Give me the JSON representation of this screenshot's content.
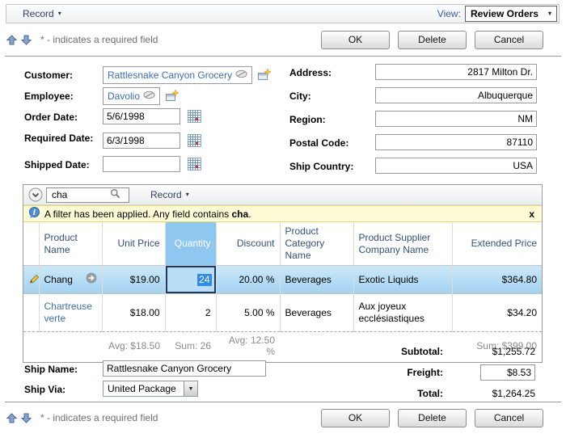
{
  "menubar": {
    "record": "Record",
    "view_label": "View:",
    "view_value": "Review Orders"
  },
  "toolbar": {
    "required_note": "* - indicates a required field",
    "ok_label": "OK",
    "delete_label": "Delete",
    "cancel_label": "Cancel"
  },
  "icons": {
    "caret_down": "▾",
    "select_arrow": "▼"
  },
  "fields": {
    "customer": {
      "label": "Customer:",
      "value": "Rattlesnake Canyon Grocery"
    },
    "employee": {
      "label": "Employee:",
      "value": "Davolio"
    },
    "order_date": {
      "label": "Order Date:",
      "value": "5/6/1998"
    },
    "required_date": {
      "label": "Required Date:",
      "value": "6/3/1998"
    },
    "shipped_date": {
      "label": "Shipped Date:",
      "value": ""
    },
    "address": {
      "label": "Address:",
      "value": "2817 Milton Dr."
    },
    "city": {
      "label": "City:",
      "value": "Albuquerque"
    },
    "region": {
      "label": "Region:",
      "value": "NM"
    },
    "postal_code": {
      "label": "Postal Code:",
      "value": "87110"
    },
    "ship_country": {
      "label": "Ship Country:",
      "value": "USA"
    },
    "ship_name": {
      "label": "Ship Name:",
      "value": "Rattlesnake Canyon Grocery"
    },
    "ship_via": {
      "label": "Ship Via:",
      "value": "United Package"
    }
  },
  "details_grid": {
    "search_value": "cha",
    "record_menu": "Record",
    "filter_message_prefix": "A filter has been applied. Any field contains ",
    "filter_term": "cha",
    "filter_suffix": ".",
    "close_label": "x",
    "columns": [
      "Product Name",
      "Unit Price",
      "Quantity",
      "Discount",
      "Product Category Name",
      "Product Supplier Company Name",
      "Extended Price"
    ],
    "rows": [
      {
        "selected": true,
        "product_name": "Chang",
        "unit_price": "$19.00",
        "quantity": "24",
        "discount": "20.00 %",
        "category": "Beverages",
        "supplier": "Exotic Liquids",
        "extended_price": "$364.80"
      },
      {
        "selected": false,
        "product_name": "Chartreuse verte",
        "unit_price": "$18.00",
        "quantity": "2",
        "discount": "5.00 %",
        "category": "Beverages",
        "supplier": "Aux joyeux ecclésiastiques",
        "extended_price": "$34.20"
      }
    ],
    "footer": {
      "unit_price": "Avg: $18.50",
      "quantity": "Sum: 26",
      "discount": "Avg: 12.50 %",
      "extended_price": "Sum: $399.00"
    }
  },
  "totals": {
    "subtotal_label": "Subtotal:",
    "subtotal_value": "$1,255.72",
    "freight_label": "Freight:",
    "freight_value": "$8.53",
    "total_label": "Total:",
    "total_value": "$1,264.25"
  },
  "colors": {
    "link_blue": "#3B6CBC",
    "grid_header_text": "#33517B",
    "quantity_header_bg": "#8EC7EF",
    "selected_row_bg": "#A2D2F0",
    "edit_cell_border": "#1B3A66",
    "text_selection_bg": "#2F8CE8",
    "filter_bar_bg": "#FFFBD6"
  }
}
